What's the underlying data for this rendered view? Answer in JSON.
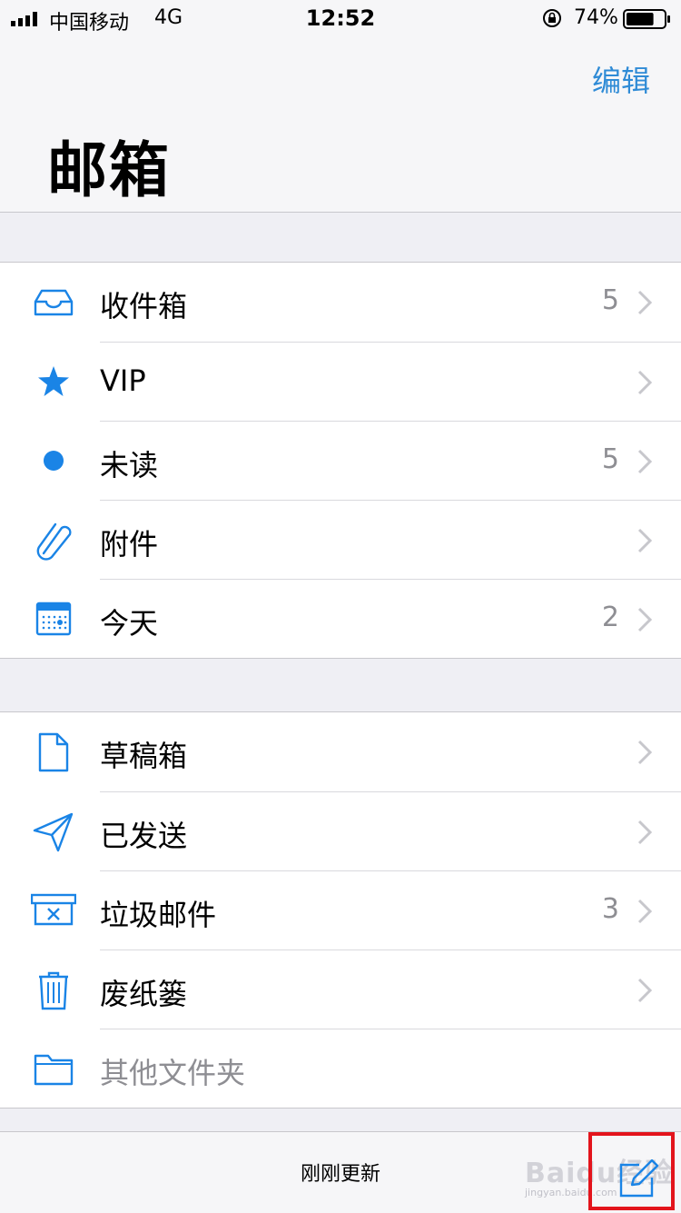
{
  "status_bar": {
    "carrier": "中国移动",
    "network": "4G",
    "time": "12:52",
    "battery_percent": "74%",
    "battery_level": 0.74
  },
  "header": {
    "edit_label": "编辑",
    "title": "邮箱"
  },
  "mailboxes": [
    {
      "label": "收件箱",
      "count": "5",
      "icon": "inbox-icon"
    },
    {
      "label": "VIP",
      "count": "",
      "icon": "star-icon"
    },
    {
      "label": "未读",
      "count": "5",
      "icon": "unread-dot-icon"
    },
    {
      "label": "附件",
      "count": "",
      "icon": "paperclip-icon"
    },
    {
      "label": "今天",
      "count": "2",
      "icon": "calendar-icon"
    }
  ],
  "folders": [
    {
      "label": "草稿箱",
      "count": "",
      "icon": "draft-icon"
    },
    {
      "label": "已发送",
      "count": "",
      "icon": "sent-icon"
    },
    {
      "label": "垃圾邮件",
      "count": "3",
      "icon": "junk-icon"
    },
    {
      "label": "废纸篓",
      "count": "",
      "icon": "trash-icon"
    },
    {
      "label": "其他文件夹",
      "count": "",
      "icon": "folder-icon"
    }
  ],
  "toolbar": {
    "status_text": "刚刚更新"
  },
  "watermark": {
    "text": "Baidu经验",
    "sub": "jingyan.baidu.com"
  },
  "colors": {
    "accent": "#2f8bd6",
    "icon_blue": "#1a84e6",
    "highlight_box": "#e3141c"
  }
}
